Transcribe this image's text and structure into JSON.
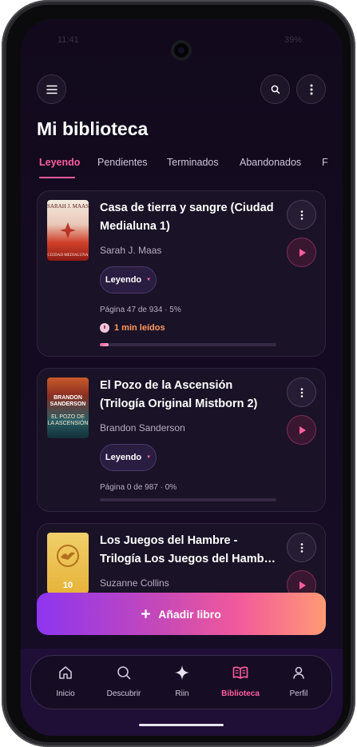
{
  "status_bar": {
    "time_faded": "11:41",
    "battery_faded": "39%"
  },
  "header": {
    "menu_icon": "hamburger-menu-icon",
    "search_icon": "search-icon",
    "more_icon": "more-vertical-icon",
    "title": "Mi biblioteca"
  },
  "tabs": [
    {
      "label": "Leyendo",
      "active": true
    },
    {
      "label": "Pendientes",
      "active": false
    },
    {
      "label": "Terminados",
      "active": false
    },
    {
      "label": "Abandonados",
      "active": false
    },
    {
      "label": "F",
      "active": false
    }
  ],
  "books": [
    {
      "title": "Casa de tierra y sangre (Ciudad Medialuna 1)",
      "author": "Sarah J. Maas",
      "status": "Leyendo",
      "progress_text": "Página 47 de 934 · 5%",
      "progress_percent": 5,
      "time_read": "1 min leídos",
      "cover": {
        "top": "SARAH J. MAAS",
        "bottom": "CIUDAD MEDIALUNA"
      }
    },
    {
      "title": "El Pozo de la Ascensión (Trilogía Original Mistborn 2)",
      "author": "Brandon Sanderson",
      "status": "Leyendo",
      "progress_text": "Página 0 de 987 · 0%",
      "progress_percent": 0,
      "cover": {
        "top": "BRANDON SANDERSON",
        "bottom": "EL POZO DE LA ASCENSIÓN"
      }
    },
    {
      "title": "Los Juegos del Hambre - Trilogía Los Juegos del Hamb…",
      "author": "Suzanne Collins",
      "cover": {
        "badge": "10"
      }
    }
  ],
  "add_button": {
    "label": "Añadir libro",
    "icon": "plus-icon"
  },
  "bottom_nav": [
    {
      "label": "Inicio",
      "icon": "home-icon",
      "active": false
    },
    {
      "label": "Descubrir",
      "icon": "search-icon",
      "active": false
    },
    {
      "label": "Riin",
      "icon": "sparkle-icon",
      "active": false
    },
    {
      "label": "Biblioteca",
      "icon": "open-book-icon",
      "active": true
    },
    {
      "label": "Perfil",
      "icon": "user-icon",
      "active": false
    }
  ],
  "colors": {
    "accent": "#ff5e9f",
    "time_accent": "#ff9b5e",
    "background": "#140b21",
    "card": "#1a1226"
  }
}
